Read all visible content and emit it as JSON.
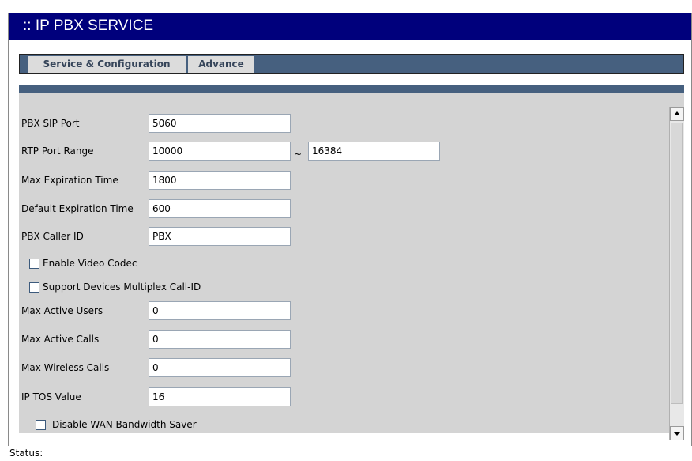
{
  "header": {
    "title": ":: IP PBX SERVICE"
  },
  "tabs": [
    {
      "label": "Service & Configuration"
    },
    {
      "label": "Advance"
    }
  ],
  "form": {
    "pbx_sip_port": {
      "label": "PBX SIP Port",
      "value": "5060"
    },
    "rtp_port_range": {
      "label": "RTP Port Range",
      "from": "10000",
      "separator": "~",
      "to": "16384"
    },
    "max_expiration_time": {
      "label": "Max Expiration Time",
      "value": "1800"
    },
    "default_expiration_time": {
      "label": "Default Expiration Time",
      "value": "600"
    },
    "pbx_caller_id": {
      "label": "PBX Caller ID",
      "value": "PBX"
    },
    "enable_video_codec": {
      "label": "Enable Video Codec",
      "checked": false
    },
    "support_multiplex_callid": {
      "label": "Support Devices Multiplex Call-ID",
      "checked": false
    },
    "max_active_users": {
      "label": "Max Active Users",
      "value": "0"
    },
    "max_active_calls": {
      "label": "Max Active Calls",
      "value": "0"
    },
    "max_wireless_calls": {
      "label": "Max Wireless Calls",
      "value": "0"
    },
    "ip_tos_value": {
      "label": "IP TOS Value",
      "value": "16"
    },
    "disable_wan_bandwidth_saver": {
      "label": "Disable WAN Bandwidth Saver",
      "checked": false
    }
  },
  "status": {
    "label": "Status:"
  },
  "colors": {
    "title_bar": "#00007c",
    "tab_strip": "#46607f",
    "panel": "#d4d4d4",
    "tab": "#dcdcdc"
  }
}
